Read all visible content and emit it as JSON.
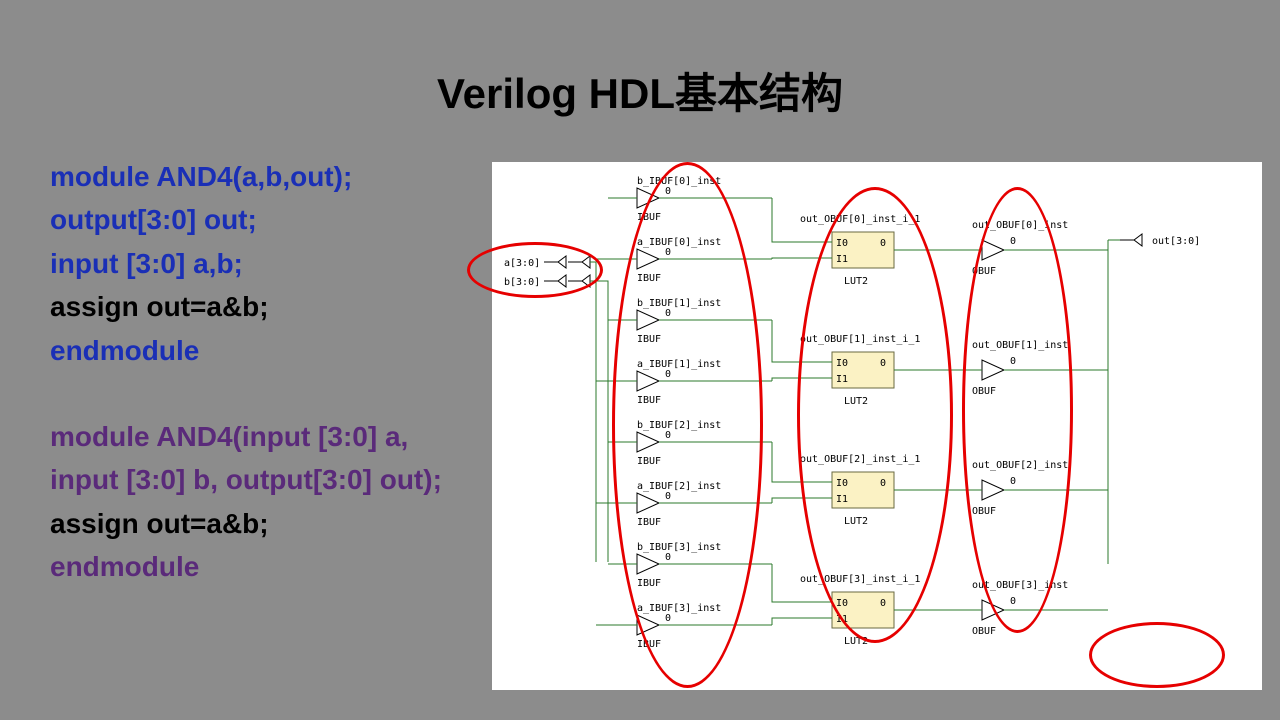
{
  "title": "Verilog HDL基本结构",
  "code1": {
    "l1": "module AND4(a,b,out);",
    "l2": "output[3:0] out;",
    "l3": "input [3:0] a,b;",
    "l4": "assign out=a&b;",
    "l5": "endmodule"
  },
  "code2": {
    "l1": "module AND4(input [3:0] a, input [3:0] b, output[3:0] out);",
    "l2": "assign out=a&b;",
    "l3": "endmodule"
  },
  "schematic": {
    "inputs": [
      "a[3:0]",
      "b[3:0]"
    ],
    "output": "out[3:0]",
    "ibufs": [
      {
        "name": "b_IBUF[0]_inst",
        "type": "IBUF"
      },
      {
        "name": "a_IBUF[0]_inst",
        "type": "IBUF"
      },
      {
        "name": "b_IBUF[1]_inst",
        "type": "IBUF"
      },
      {
        "name": "a_IBUF[1]_inst",
        "type": "IBUF"
      },
      {
        "name": "b_IBUF[2]_inst",
        "type": "IBUF"
      },
      {
        "name": "a_IBUF[2]_inst",
        "type": "IBUF"
      },
      {
        "name": "b_IBUF[3]_inst",
        "type": "IBUF"
      },
      {
        "name": "a_IBUF[3]_inst",
        "type": "IBUF"
      }
    ],
    "luts": [
      {
        "name": "out_OBUF[0]_inst_i_1",
        "type": "LUT2",
        "p0": "I0",
        "p1": "I1",
        "o": "0"
      },
      {
        "name": "out_OBUF[1]_inst_i_1",
        "type": "LUT2",
        "p0": "I0",
        "p1": "I1",
        "o": "0"
      },
      {
        "name": "out_OBUF[2]_inst_i_1",
        "type": "LUT2",
        "p0": "I0",
        "p1": "I1",
        "o": "0"
      },
      {
        "name": "out_OBUF[3]_inst_i_1",
        "type": "LUT2",
        "p0": "I0",
        "p1": "I1",
        "o": "0"
      }
    ],
    "obufs": [
      {
        "name": "out_OBUF[0]_inst",
        "type": "OBUF"
      },
      {
        "name": "out_OBUF[1]_inst",
        "type": "OBUF"
      },
      {
        "name": "out_OBUF[2]_inst",
        "type": "OBUF"
      },
      {
        "name": "out_OBUF[3]_inst",
        "type": "OBUF"
      }
    ],
    "zero_label": "0"
  }
}
